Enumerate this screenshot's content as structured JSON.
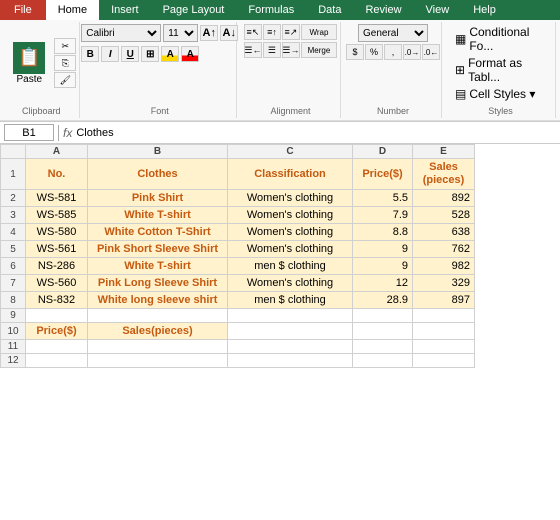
{
  "tabs": [
    {
      "label": "File",
      "active": false
    },
    {
      "label": "Home",
      "active": true
    },
    {
      "label": "Insert",
      "active": false
    },
    {
      "label": "Page Layout",
      "active": false
    },
    {
      "label": "Formulas",
      "active": false
    },
    {
      "label": "Data",
      "active": false
    },
    {
      "label": "Review",
      "active": false
    },
    {
      "label": "View",
      "active": false
    },
    {
      "label": "Help",
      "active": false
    }
  ],
  "ribbon": {
    "font_name": "Calibri",
    "font_size": "11",
    "groups": [
      "Clipboard",
      "Font",
      "Alignment",
      "Number",
      "Styles"
    ],
    "styles_items": [
      "Conditional Fo...",
      "Format as Tabl...",
      "Cell Styles ▾"
    ]
  },
  "formula_bar": {
    "cell_ref": "B1",
    "formula": "Clothes"
  },
  "col_headers": [
    "",
    "A",
    "B",
    "C",
    "D",
    "E"
  ],
  "headers": {
    "no": "No.",
    "clothes": "Clothes",
    "classification": "Classification",
    "price": "Price($)",
    "sales": "Sales\n(pieces)"
  },
  "rows": [
    {
      "row": "2",
      "no": "WS-581",
      "clothes": "Pink Shirt",
      "class": "Women's clothing",
      "price": "5.5",
      "sales": "892"
    },
    {
      "row": "3",
      "no": "WS-585",
      "clothes": "White T-shirt",
      "class": "Women's clothing",
      "price": "7.9",
      "sales": "528"
    },
    {
      "row": "4",
      "no": "WS-580",
      "clothes": "White Cotton T-Shirt",
      "class": "Women's clothing",
      "price": "8.8",
      "sales": "638"
    },
    {
      "row": "5",
      "no": "WS-561",
      "clothes": "Pink Short Sleeve Shirt",
      "class": "Women's clothing",
      "price": "9",
      "sales": "762"
    },
    {
      "row": "6",
      "no": "NS-286",
      "clothes": "White T-shirt",
      "class": "men $ clothing",
      "price": "9",
      "sales": "982"
    },
    {
      "row": "7",
      "no": "WS-560",
      "clothes": "Pink Long Sleeve Shirt",
      "class": "Women's clothing",
      "price": "12",
      "sales": "329"
    },
    {
      "row": "8",
      "no": "NS-832",
      "clothes": "White long sleeve shirt",
      "class": "men $ clothing",
      "price": "28.9",
      "sales": "897"
    }
  ],
  "extra_rows": [
    {
      "row": "9",
      "no": "",
      "clothes": "",
      "class": "",
      "price": "",
      "sales": ""
    },
    {
      "row": "10",
      "no": "Price($)",
      "clothes": "Sales(pieces)",
      "class": "",
      "price": "",
      "sales": ""
    },
    {
      "row": "11",
      "no": "",
      "clothes": "",
      "class": "",
      "price": "",
      "sales": ""
    },
    {
      "row": "12",
      "no": "",
      "clothes": "",
      "class": "",
      "price": "",
      "sales": ""
    }
  ]
}
